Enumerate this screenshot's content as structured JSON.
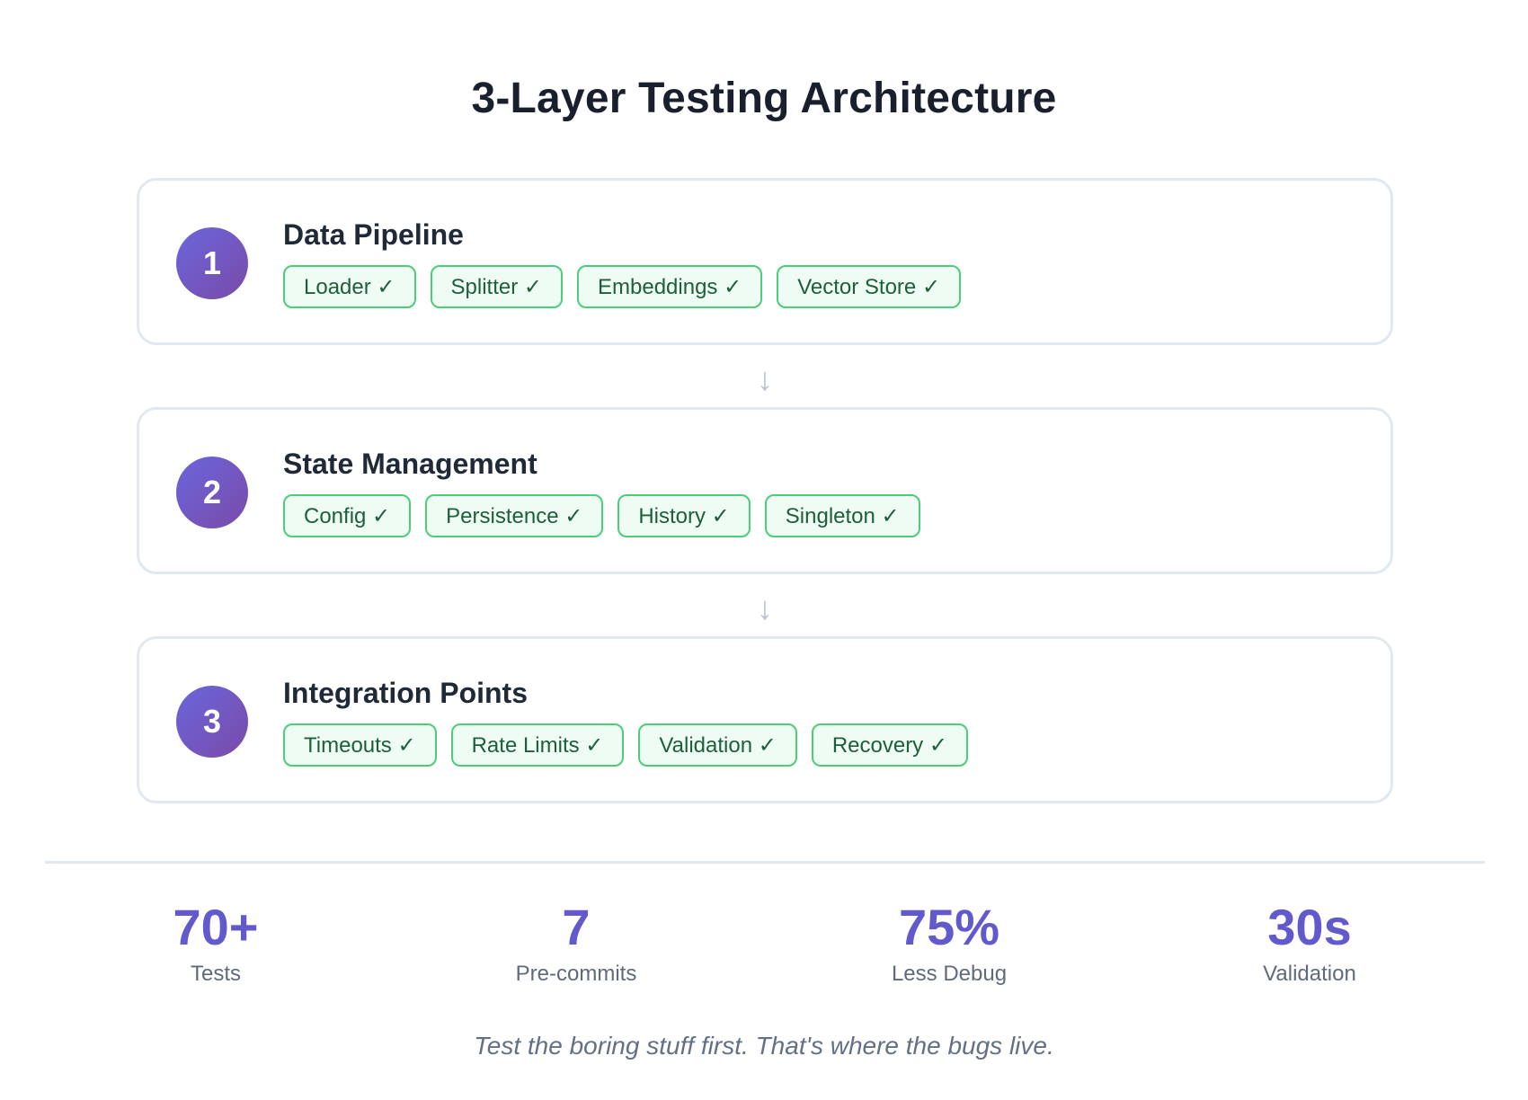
{
  "title": "3-Layer Testing Architecture",
  "layers": [
    {
      "number": "1",
      "title": "Data Pipeline",
      "tags": [
        "Loader ✓",
        "Splitter ✓",
        "Embeddings ✓",
        "Vector Store ✓"
      ]
    },
    {
      "number": "2",
      "title": "State Management",
      "tags": [
        "Config ✓",
        "Persistence ✓",
        "History ✓",
        "Singleton ✓"
      ]
    },
    {
      "number": "3",
      "title": "Integration Points",
      "tags": [
        "Timeouts ✓",
        "Rate Limits ✓",
        "Validation ✓",
        "Recovery ✓"
      ]
    }
  ],
  "arrows": [
    "↓",
    "↓"
  ],
  "stats": [
    {
      "value": "70+",
      "label": "Tests"
    },
    {
      "value": "7",
      "label": "Pre-commits"
    },
    {
      "value": "75%",
      "label": "Less Debug"
    },
    {
      "value": "30s",
      "label": "Validation"
    }
  ],
  "tagline": "Test the boring stuff first. That's where the bugs live.",
  "colors": {
    "accent": "#6259cc",
    "tag_border": "#4ccd7a",
    "tag_bg": "#effcf3",
    "tag_text": "#1d5f3a",
    "card_border": "#e2e8f0"
  }
}
